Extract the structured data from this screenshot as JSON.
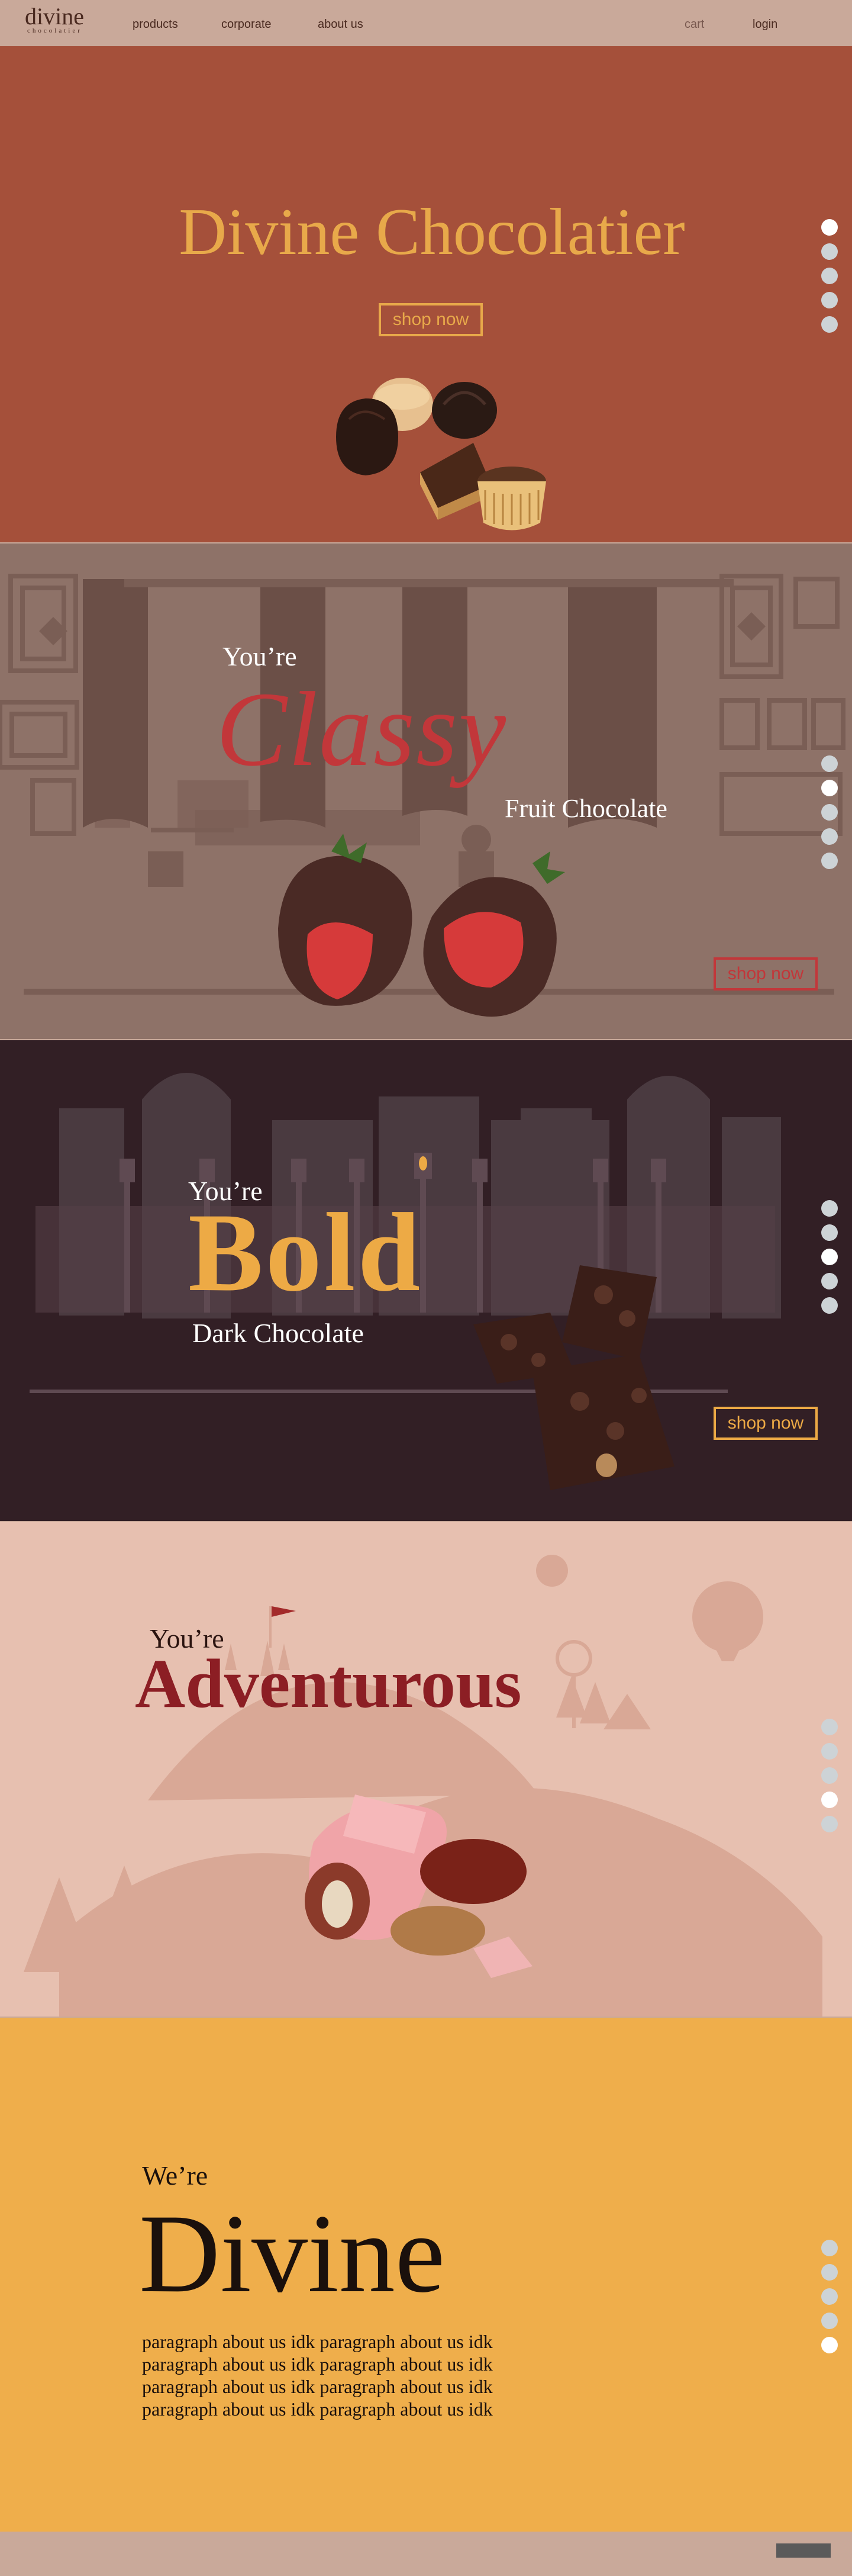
{
  "nav": {
    "logo": "divine",
    "logo_sub": "chocolatier",
    "links": [
      "products",
      "corporate",
      "about us"
    ],
    "cart": "cart",
    "login": "login"
  },
  "hero": {
    "title": "Divine Chocolatier",
    "shop_label": "shop now",
    "active_dot": 1
  },
  "classy": {
    "youre": "You’re",
    "word": "Classy",
    "subtitle": "Fruit Chocolate",
    "shop_label": "shop now",
    "active_dot": 2
  },
  "bold": {
    "youre": "You’re",
    "word": "Bold",
    "subtitle": "Dark Chocolate",
    "shop_label": "shop now",
    "active_dot": 3
  },
  "adventurous": {
    "youre": "You’re",
    "word": "Adventurous",
    "active_dot": 4
  },
  "divine": {
    "were": "We’re",
    "word": "Divine",
    "paragraph": [
      "paragraph about us idk paragraph about us idk",
      "paragraph about us idk paragraph about us idk",
      "paragraph about us idk paragraph about us idk",
      "paragraph about us idk paragraph about us idk"
    ],
    "active_dot": 5
  },
  "colors": {
    "nav": "#c9a99a",
    "hero_bg": "#a5503a",
    "hero_gold": "#e8a94a",
    "classy_bg": "#8e7268",
    "classy_red": "#c2373a",
    "bold_bg": "#321f25",
    "bold_gold": "#edaa45",
    "adventurous_bg": "#e7c0b0",
    "adventurous_red": "#8c1e24",
    "divine_bg": "#efae4b"
  }
}
